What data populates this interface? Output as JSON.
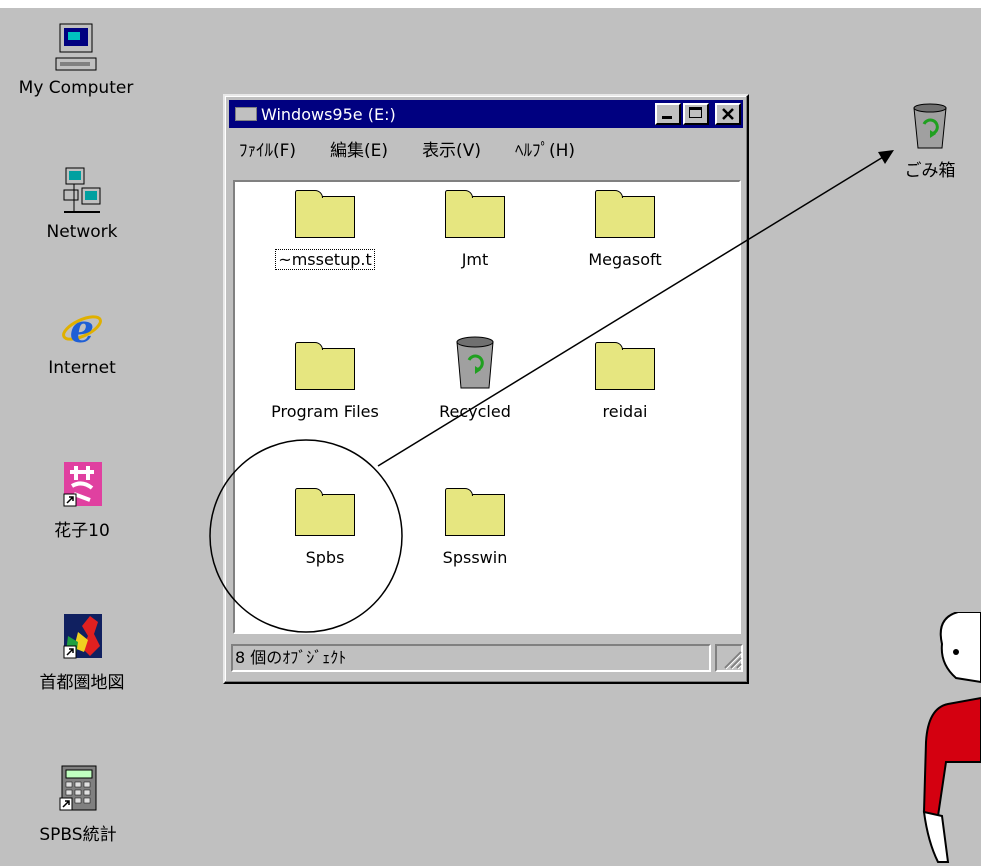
{
  "desktop": {
    "icons": [
      {
        "label": "My Computer",
        "icon": "computer-icon"
      },
      {
        "label": "Network",
        "icon": "network-icon"
      },
      {
        "label": "Internet",
        "icon": "ie-icon"
      },
      {
        "label": "花子10",
        "icon": "hanako-shortcut-icon"
      },
      {
        "label": "首都圏地図",
        "icon": "map-shortcut-icon"
      },
      {
        "label": "SPBS統計",
        "icon": "calculator-shortcut-icon"
      },
      {
        "label": "ごみ箱",
        "icon": "recycle-bin-icon"
      }
    ]
  },
  "window": {
    "title": "Windows95e (E:)",
    "menu": [
      "ﾌｧｲﾙ(F)",
      "編集(E)",
      "表示(V)",
      "ﾍﾙﾌﾟ(H)"
    ],
    "items": [
      {
        "label": "~mssetup.t",
        "type": "folder",
        "selected": true
      },
      {
        "label": "Jmt",
        "type": "folder"
      },
      {
        "label": "Megasoft",
        "type": "folder"
      },
      {
        "label": "Program Files",
        "type": "folder"
      },
      {
        "label": "Recycled",
        "type": "recycle-bin"
      },
      {
        "label": "reidai",
        "type": "folder"
      },
      {
        "label": "Spbs",
        "type": "folder"
      },
      {
        "label": "Spsswin",
        "type": "folder"
      }
    ],
    "status": "8 個のｵﾌﾞｼﾞｪｸﾄ"
  },
  "colors": {
    "desktop": "#c0c0c0",
    "titlebar": "#000080",
    "folder": "#e6e680"
  }
}
